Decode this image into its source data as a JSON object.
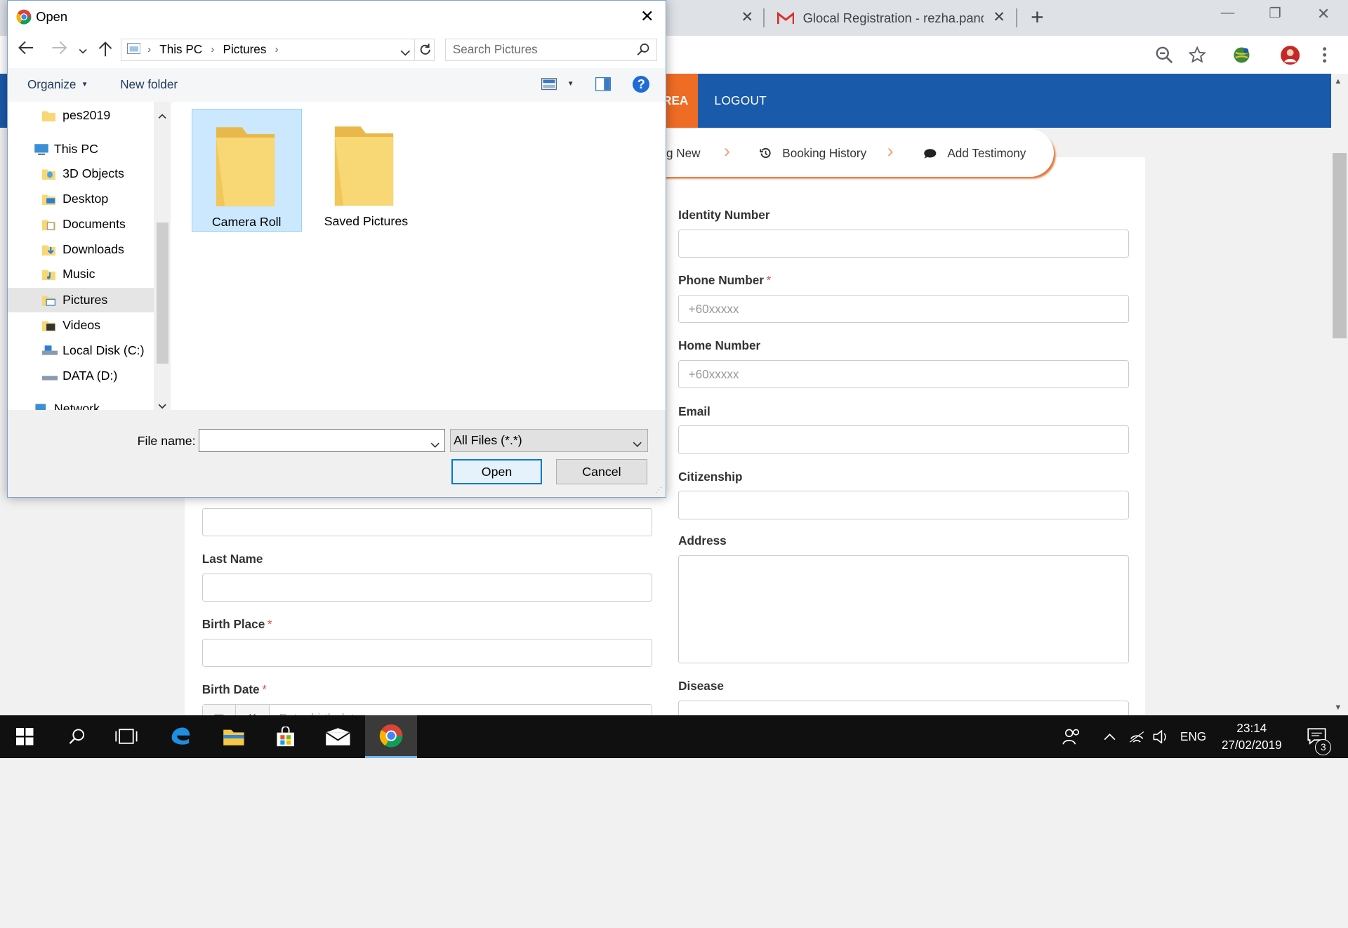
{
  "browser": {
    "tab2_title": "Glocal Registration - rezha.pandu",
    "close_glyph": "✕",
    "new_tab_glyph": "+",
    "minimize_glyph": "—",
    "restore_glyph": "❐",
    "window_close_glyph": "✕"
  },
  "site": {
    "nav_partial": "REA",
    "nav_logout": "LOGOUT",
    "breadcrumbs": [
      "g New",
      "Booking History",
      "Add Testimony"
    ],
    "fields_right": [
      {
        "label": "Identity Number",
        "required": false,
        "placeholder": ""
      },
      {
        "label": "Phone Number",
        "required": true,
        "placeholder": "+60xxxxx"
      },
      {
        "label": "Home Number",
        "required": false,
        "placeholder": "+60xxxxx"
      },
      {
        "label": "Email",
        "required": false,
        "placeholder": ""
      },
      {
        "label": "Citizenship",
        "required": false,
        "placeholder": ""
      },
      {
        "label": "Address",
        "required": false,
        "placeholder": ""
      },
      {
        "label": "Disease",
        "required": false,
        "placeholder": ""
      }
    ],
    "fields_left": [
      {
        "label": "Last Name",
        "required": false
      },
      {
        "label": "Birth Place",
        "required": true
      },
      {
        "label": "Birth Date",
        "required": true,
        "placeholder": "Enter birth date"
      }
    ],
    "required_mark": "*"
  },
  "dialog": {
    "title": "Open",
    "close_glyph": "✕",
    "breadcrumb": [
      "This PC",
      "Pictures"
    ],
    "search_placeholder": "Search Pictures",
    "organize_label": "Organize",
    "new_folder_label": "New folder",
    "help_glyph": "?",
    "nav_items": [
      {
        "label": "pes2019",
        "icon": "folder-icon"
      },
      {
        "label": "This PC",
        "icon": "computer-icon"
      },
      {
        "label": "3D Objects",
        "icon": "cube-icon"
      },
      {
        "label": "Desktop",
        "icon": "desktop-icon"
      },
      {
        "label": "Documents",
        "icon": "documents-icon"
      },
      {
        "label": "Downloads",
        "icon": "downloads-icon"
      },
      {
        "label": "Music",
        "icon": "music-icon"
      },
      {
        "label": "Pictures",
        "icon": "pictures-icon"
      },
      {
        "label": "Videos",
        "icon": "videos-icon"
      },
      {
        "label": "Local Disk (C:)",
        "icon": "drive-icon"
      },
      {
        "label": "DATA (D:)",
        "icon": "drive-icon"
      },
      {
        "label": "Network",
        "icon": "network-icon"
      }
    ],
    "selected_nav": "Pictures",
    "folders": [
      "Camera Roll",
      "Saved Pictures"
    ],
    "selected_folder": "Camera Roll",
    "file_name_label": "File name:",
    "file_name_value": "",
    "file_type_value": "All Files (*.*)",
    "open_button": "Open",
    "cancel_button": "Cancel"
  },
  "taskbar": {
    "language": "ENG",
    "time": "23:14",
    "date": "27/02/2019",
    "notification_count": "3"
  },
  "colors": {
    "nav_blue": "#1a5aab",
    "nav_orange": "#ef6c24",
    "selection_blue": "#cce8ff",
    "folder_yellow": "#f8d775"
  }
}
